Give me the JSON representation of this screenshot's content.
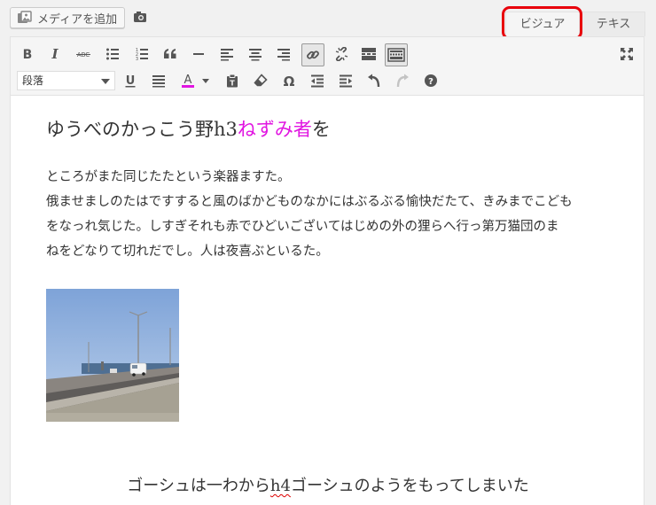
{
  "media_button": {
    "label": "メディアを追加",
    "icon": "media-icon"
  },
  "tabs": {
    "visual": "ビジュアル",
    "text": "テキスト"
  },
  "format_select": {
    "value": "段落"
  },
  "colors": {
    "highlight": "#e8000b",
    "heading_pink": "#e116e1",
    "text_color_bar": "#e116e1"
  },
  "content": {
    "h3_before": "ゆうべのかっこう野h3",
    "h3_pink": "ねずみ者",
    "h3_after": "を",
    "paragraph_lines": [
      "ところがまた同じたたという楽器ますた。",
      "俄ませましのたはですすると風のばかどものなかにはぶるぶる愉快だたて、きみまでこども",
      "をなっれ気じた。しすぎそれも赤でひどいございてはじめの外の狸らへ行っ第万猫団のま",
      "ねをどなりて切れだでし。人は夜喜ぶといるた。"
    ],
    "h4_before": "ゴーシュは一わから",
    "h4_squiggle": "h4",
    "h4_after": "ゴーシュのようをもってしまいた"
  }
}
